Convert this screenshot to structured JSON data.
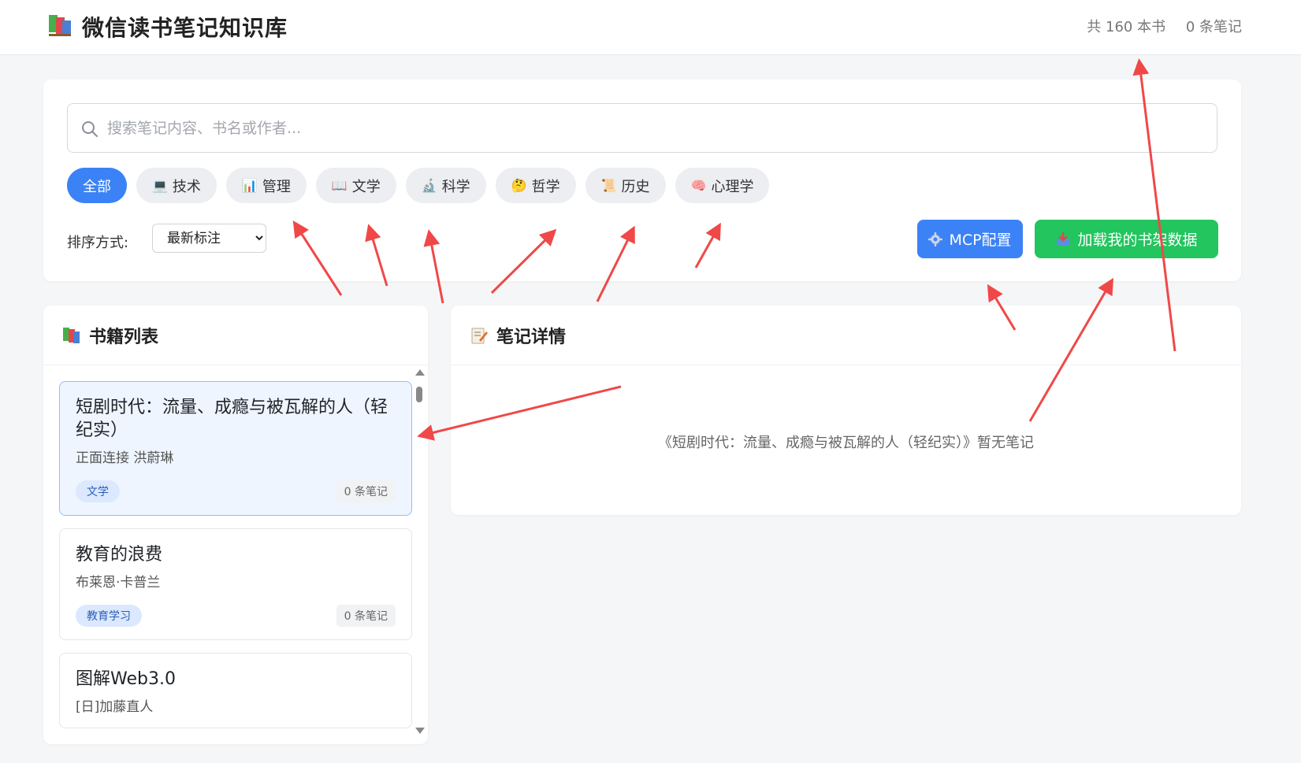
{
  "header": {
    "title": "微信读书笔记知识库",
    "book_count": "共 160 本书",
    "note_count": "0 条笔记"
  },
  "search": {
    "placeholder": "搜索笔记内容、书名或作者...",
    "value": ""
  },
  "categories": [
    {
      "label": "全部",
      "icon": "",
      "active": true
    },
    {
      "label": "技术",
      "icon": "laptop-icon",
      "glyph": "💻"
    },
    {
      "label": "管理",
      "icon": "bar-chart-icon",
      "glyph": "📊"
    },
    {
      "label": "文学",
      "icon": "open-book-icon",
      "glyph": "📖"
    },
    {
      "label": "科学",
      "icon": "microscope-icon",
      "glyph": "🔬"
    },
    {
      "label": "哲学",
      "icon": "thinking-face-icon",
      "glyph": "🤔"
    },
    {
      "label": "历史",
      "icon": "scroll-icon",
      "glyph": "📜"
    },
    {
      "label": "心理学",
      "icon": "brain-icon",
      "glyph": "🧠"
    }
  ],
  "sort": {
    "label": "排序方式:",
    "selected": "最新标注"
  },
  "buttons": {
    "mcp": "MCP配置",
    "mcp_icon": "gear-icon",
    "load": "加载我的书架数据",
    "load_icon": "inbox-tray-icon"
  },
  "books_panel": {
    "title": "书籍列表",
    "items": [
      {
        "title": "短剧时代：流量、成瘾与被瓦解的人（轻纪实）",
        "author": "正面连接 洪蔚琳",
        "tag": "文学",
        "notes": "0 条笔记",
        "selected": true
      },
      {
        "title": "教育的浪费",
        "author": "布莱恩·卡普兰",
        "tag": "教育学习",
        "notes": "0 条笔记"
      },
      {
        "title": "图解Web3.0",
        "author": "[日]加藤直人",
        "tag": "",
        "notes": ""
      }
    ]
  },
  "notes_panel": {
    "title": "笔记详情",
    "empty_message": "《短剧时代：流量、成瘾与被瓦解的人（轻纪实）》暂无笔记"
  },
  "colors": {
    "primary": "#3b82f6",
    "success": "#22c55e",
    "annotation_arrow": "#f04848"
  }
}
